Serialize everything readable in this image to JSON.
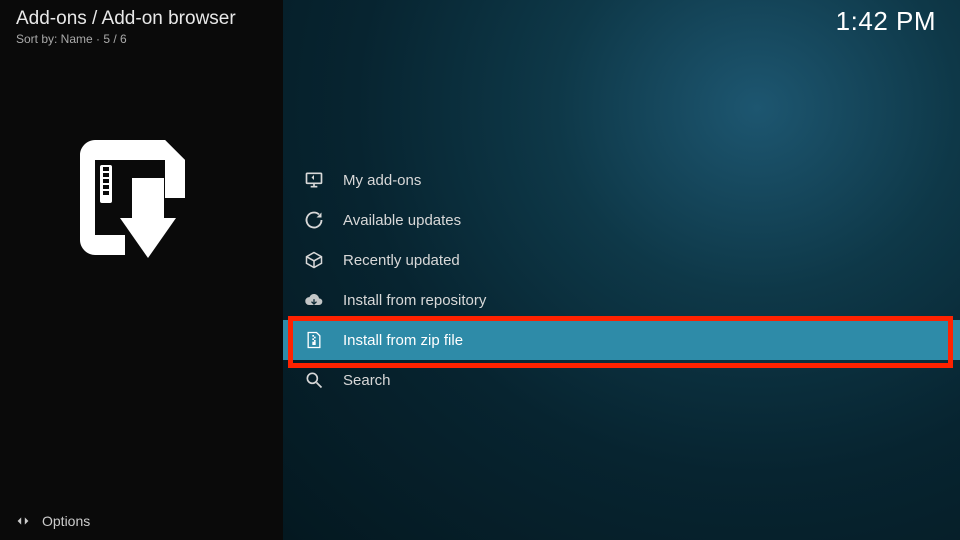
{
  "header": {
    "breadcrumb": "Add-ons / Add-on browser",
    "sort_label": "Sort by: Name  ·  5 / 6"
  },
  "clock": "1:42 PM",
  "menu": {
    "items": [
      {
        "label": "My add-ons",
        "icon": "monitor-icon"
      },
      {
        "label": "Available updates",
        "icon": "refresh-icon"
      },
      {
        "label": "Recently updated",
        "icon": "box-icon"
      },
      {
        "label": "Install from repository",
        "icon": "cloud-download-icon"
      },
      {
        "label": "Install from zip file",
        "icon": "zip-file-icon"
      },
      {
        "label": "Search",
        "icon": "search-icon"
      }
    ],
    "selected_index": 4
  },
  "footer": {
    "options_label": "Options"
  }
}
